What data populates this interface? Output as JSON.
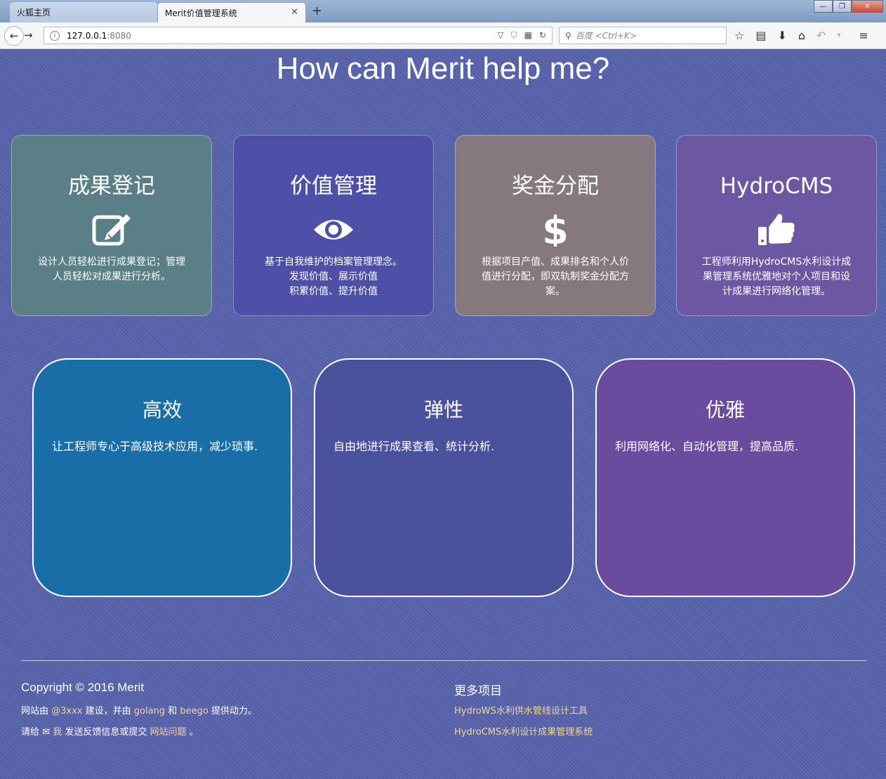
{
  "browser": {
    "tabs": [
      {
        "label": "火狐主页"
      },
      {
        "label": "Merit价值管理系统"
      }
    ],
    "url_host": "127.0.0.1",
    "url_port": ":8080",
    "search_placeholder": "百度 <Ctrl+K>"
  },
  "hero": {
    "title": "How can Merit help me?"
  },
  "cards": [
    {
      "title": "成果登记",
      "icon": "edit-icon",
      "desc": "设计人员轻松进行成果登记；管理\n人员轻松对成果进行分析。",
      "bg": "#5b7f86"
    },
    {
      "title": "价值管理",
      "icon": "eye-icon",
      "desc": "基于自我维护的档案管理理念。\n发现价值、展示价值\n积累价值、提升价值",
      "bg": "#4e4fa6"
    },
    {
      "title": "奖金分配",
      "icon": "dollar-icon",
      "desc": "根据项目产值、成果排名和个人价\n值进行分配，即双轨制奖金分配方\n案。",
      "bg": "#85797f"
    },
    {
      "title": "HydroCMS",
      "icon": "thumbs-up-icon",
      "desc": "工程师利用HydroCMS水利设计成\n果管理系统优雅地对个人项目和设\n计成果进行网络化管理。",
      "bg": "#6c57a3"
    }
  ],
  "features": [
    {
      "title": "高效",
      "desc": "让工程师专心于高级技术应用，减少琐事.",
      "bg": "#196ea8"
    },
    {
      "title": "弹性",
      "desc": "自由地进行成果查看、统计分析.",
      "bg": "#4a529e"
    },
    {
      "title": "优雅",
      "desc": "利用网络化、自动化管理，提高品质.",
      "bg": "#6b4b9d"
    }
  ],
  "footer": {
    "copyright": "Copyright © 2016 Merit",
    "line1": {
      "pre": "网站由 ",
      "author": "@3xxx",
      "mid": " 建设，并由 ",
      "golang": "golang",
      "and": " 和 ",
      "beego": "beego",
      "post": " 提供动力。"
    },
    "line2": {
      "pre": "请给 ",
      "me": "我",
      "mid": " 发送反馈信息或提交 ",
      "issues": "网站问题",
      "post": " 。"
    },
    "more_title": "更多项目",
    "projects": [
      "HydroWS水利供水管线设计工具",
      "HydroCMS水利设计成果管理系统"
    ]
  }
}
